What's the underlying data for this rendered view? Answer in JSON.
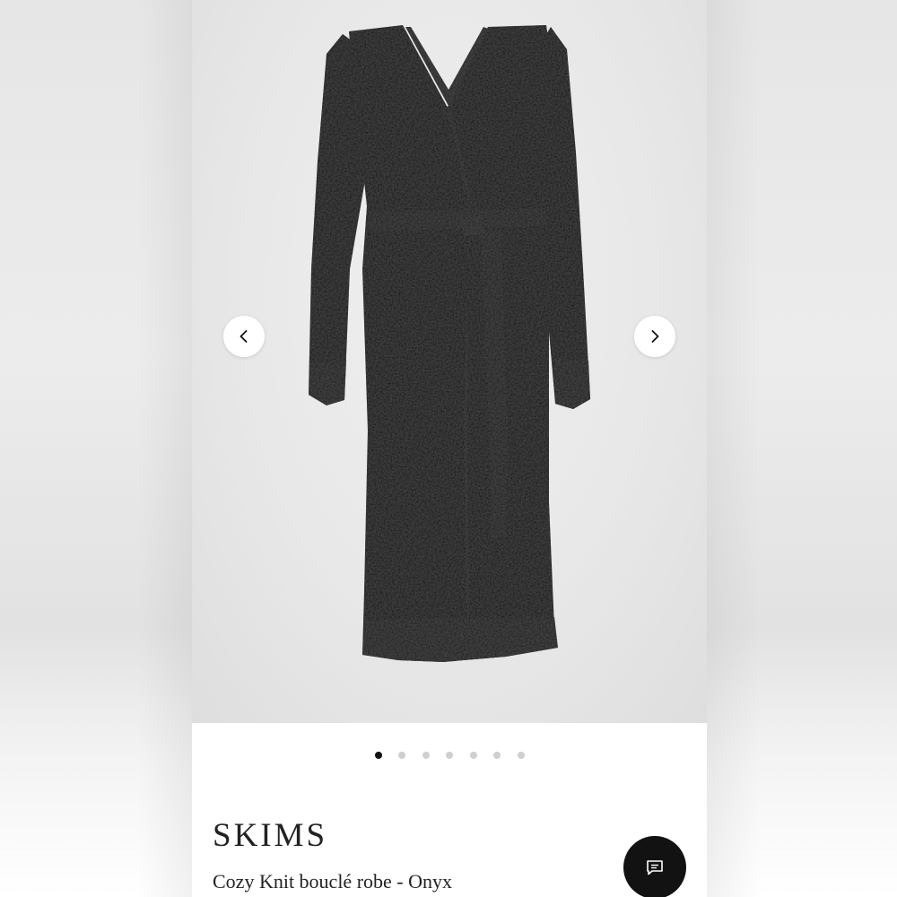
{
  "product": {
    "brand": "SKIMS",
    "name": "Cozy Knit bouclé robe - Onyx",
    "image_icon": "black-wrap-robe-image"
  },
  "gallery": {
    "total_images": 7,
    "active_index": 1,
    "prev_icon": "chevron-left-icon",
    "next_icon": "chevron-right-icon"
  },
  "chat": {
    "icon": "chat-bubble-icon"
  },
  "colors": {
    "robe": "#0d0d0d",
    "background": "#e9e9e9",
    "dot_active": "#111111",
    "dot_inactive": "#cfcfcf",
    "chat_button": "#121212"
  }
}
